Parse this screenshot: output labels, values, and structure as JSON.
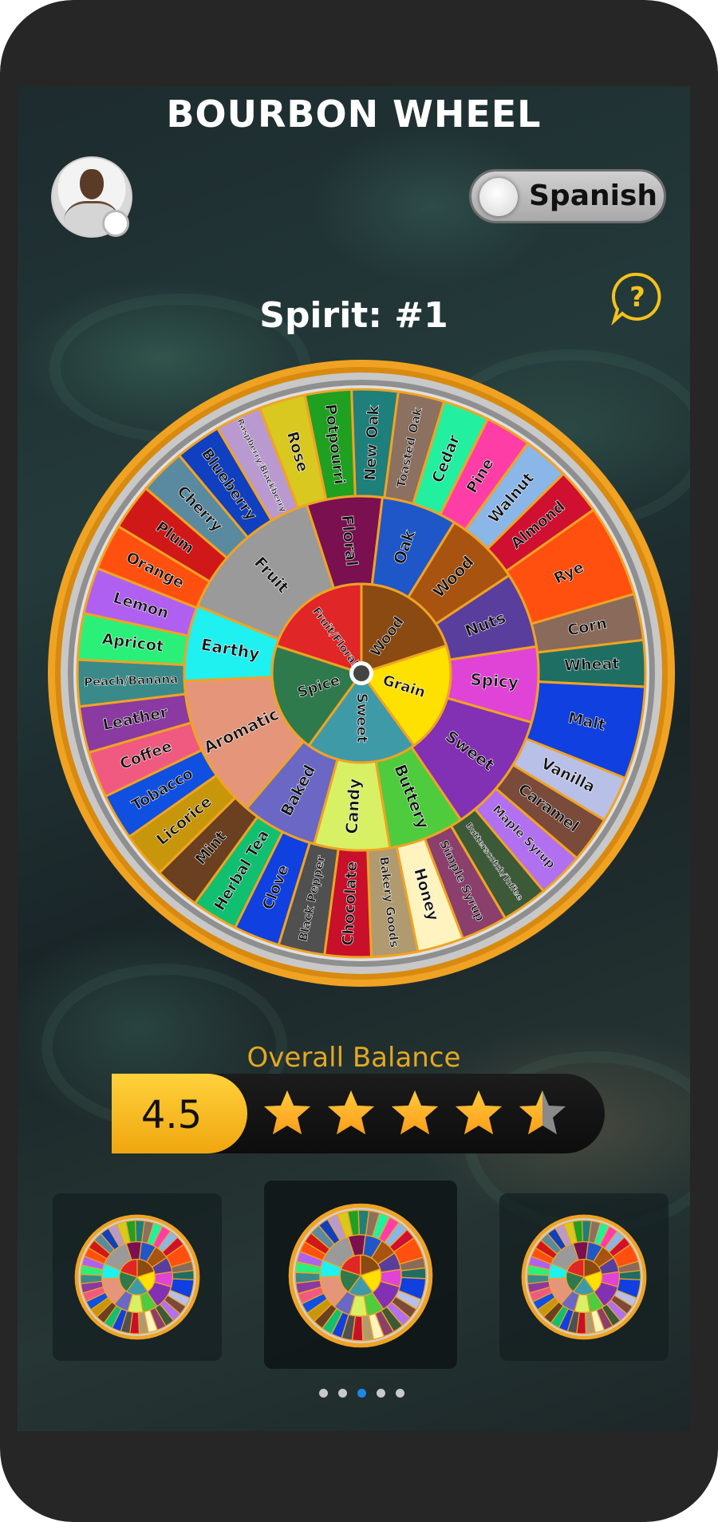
{
  "app": {
    "title": "BOURBON WHEEL"
  },
  "profile": {
    "avatar_name": "avatar"
  },
  "language_toggle": {
    "label": "Spanish",
    "state": "off"
  },
  "help": {
    "icon": "question-icon"
  },
  "spirit": {
    "title": "Spirit: #1"
  },
  "wheel": {
    "core": [
      {
        "label": "Fruit/Floral",
        "color": "#e02626"
      },
      {
        "label": "Wood",
        "color": "#8a4a12"
      },
      {
        "label": "Grain",
        "color": "#ffe100"
      },
      {
        "label": "Sweet",
        "color": "#3f9aa8"
      },
      {
        "label": "Spice",
        "color": "#2f7a4c"
      }
    ],
    "middle": [
      {
        "label": "Floral",
        "color": "#7a1050"
      },
      {
        "label": "Oak",
        "color": "#1f57c9"
      },
      {
        "label": "Wood",
        "color": "#a8530f"
      },
      {
        "label": "Nuts",
        "color": "#5a3e9e"
      },
      {
        "label": "Spicy",
        "color": "#e044d6"
      },
      {
        "label": "Sweet",
        "color": "#8230b4"
      },
      {
        "label": "Buttery",
        "color": "#4fcb3e"
      },
      {
        "label": "Candy",
        "color": "#d8f064"
      },
      {
        "label": "Baked",
        "color": "#6a68c4"
      },
      {
        "label": "Aromatic",
        "color": "#e5967a"
      },
      {
        "label": "Earthy",
        "color": "#1ff0f0"
      },
      {
        "label": "Fruit",
        "color": "#9a9a9a"
      }
    ],
    "outer": [
      {
        "label": "New Oak",
        "color": "#1f7f7a"
      },
      {
        "label": "Toasted Oak",
        "color": "#8c7060"
      },
      {
        "label": "Cedar",
        "color": "#22f0a0"
      },
      {
        "label": "Pine",
        "color": "#ff3da6"
      },
      {
        "label": "Walnut",
        "color": "#8ab6e8"
      },
      {
        "label": "Almond",
        "color": "#d01030"
      },
      {
        "label": "Rye",
        "color": "#ff5010"
      },
      {
        "label": "Corn",
        "color": "#8a6a5a"
      },
      {
        "label": "Wheat",
        "color": "#1f6e64"
      },
      {
        "label": "Malt",
        "color": "#1040e0"
      },
      {
        "label": "Vanilla",
        "color": "#b8c0e8"
      },
      {
        "label": "Caramel",
        "color": "#7a4a3a"
      },
      {
        "label": "Maple Syrup",
        "color": "#b070f0"
      },
      {
        "label": "Butterscotch/Toffee",
        "color": "#3c5a38"
      },
      {
        "label": "Simple Syrup",
        "color": "#8a3f6c"
      },
      {
        "label": "Honey",
        "color": "#fff4c0"
      },
      {
        "label": "Bakery Goods",
        "color": "#b09a70"
      },
      {
        "label": "Chocolate",
        "color": "#c8102a"
      },
      {
        "label": "Black Pepper",
        "color": "#505050"
      },
      {
        "label": "Clove",
        "color": "#1040e0"
      },
      {
        "label": "Herbal Tea",
        "color": "#10c070"
      },
      {
        "label": "Mint",
        "color": "#6a4020"
      },
      {
        "label": "Licorice",
        "color": "#c8960a"
      },
      {
        "label": "Tobacco",
        "color": "#1050e0"
      },
      {
        "label": "Coffee",
        "color": "#f05a80"
      },
      {
        "label": "Leather",
        "color": "#8a3aa0"
      },
      {
        "label": "Peach/Banana",
        "color": "#3a8a8a"
      },
      {
        "label": "Apricot",
        "color": "#2af07a"
      },
      {
        "label": "Lemon",
        "color": "#b060f0"
      },
      {
        "label": "Orange",
        "color": "#ff5010"
      },
      {
        "label": "Plum",
        "color": "#d01818"
      },
      {
        "label": "Cherry",
        "color": "#5a8aa0"
      },
      {
        "label": "Blueberry",
        "color": "#1040c0"
      },
      {
        "label": "Raspberry/Blackberry",
        "color": "#b89ad0"
      },
      {
        "label": "Rose",
        "color": "#d8c820"
      },
      {
        "label": "Potpourri",
        "color": "#20a020"
      }
    ]
  },
  "rating": {
    "label": "Overall Balance",
    "value": "4.5",
    "stars_filled": 4.5,
    "stars_total": 5
  },
  "carousel": {
    "items": [
      "wheel-1",
      "wheel-2",
      "wheel-3"
    ],
    "selected_index": 1,
    "page_count": 5,
    "active_page": 2
  },
  "colors": {
    "accent": "#f0a60f",
    "star": "#ff9d1a",
    "dot_active": "#1e88e5"
  }
}
